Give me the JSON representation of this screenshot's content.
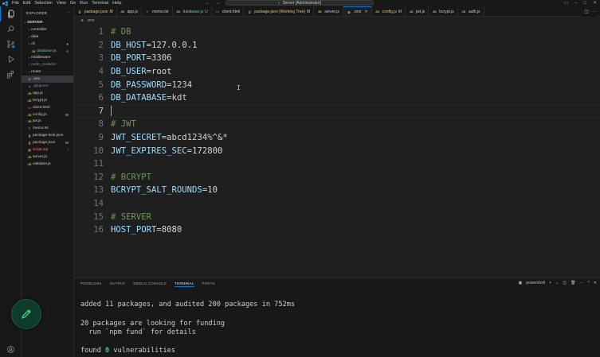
{
  "titlebar": {
    "menu": [
      "File",
      "Edit",
      "Selection",
      "View",
      "Go",
      "Run",
      "Terminal",
      "Help"
    ],
    "search_text": "Server [Administrator]"
  },
  "sidebar": {
    "title": "EXPLORER",
    "tree": [
      {
        "label": "SERVER",
        "kind": "root",
        "indent": 0,
        "chev": "⌄"
      },
      {
        "label": "controller",
        "kind": "folder",
        "indent": 1,
        "chev": "›"
      },
      {
        "label": "data",
        "kind": "folder",
        "indent": 1,
        "chev": "›"
      },
      {
        "label": "db",
        "kind": "folder",
        "indent": 1,
        "chev": "⌄",
        "color": "green",
        "badge": "●",
        "badge_color": "green"
      },
      {
        "label": "database.js",
        "kind": "js",
        "indent": 2,
        "color": "green",
        "badge": "U",
        "badge_color": "green"
      },
      {
        "label": "middleware",
        "kind": "folder",
        "indent": 1,
        "chev": "›"
      },
      {
        "label": "node_modules",
        "kind": "folder",
        "indent": 1,
        "chev": "›",
        "color": "gray"
      },
      {
        "label": "router",
        "kind": "folder",
        "indent": 1,
        "chev": "›"
      },
      {
        "label": ".env",
        "kind": "env",
        "indent": 1,
        "selected": true
      },
      {
        "label": ".gitignore",
        "kind": "git",
        "indent": 1,
        "color": "gray"
      },
      {
        "label": "app.js",
        "kind": "js",
        "indent": 1
      },
      {
        "label": "bcrypt.js",
        "kind": "js",
        "indent": 1
      },
      {
        "label": "client.html",
        "kind": "html",
        "indent": 1
      },
      {
        "label": "config.js",
        "kind": "js",
        "indent": 1,
        "color": "orange",
        "badge": "M",
        "badge_color": "orange"
      },
      {
        "label": "jwt.js",
        "kind": "js",
        "indent": 1
      },
      {
        "label": "memo.txt",
        "kind": "txt",
        "indent": 1
      },
      {
        "label": "package-lock.json",
        "kind": "json",
        "indent": 1
      },
      {
        "label": "package.json",
        "kind": "json",
        "indent": 1,
        "color": "orange",
        "badge": "M",
        "badge_color": "orange"
      },
      {
        "label": "script.sql",
        "kind": "sql",
        "indent": 1,
        "color": "red",
        "badge": "!",
        "badge_color": "red"
      },
      {
        "label": "server.js",
        "kind": "js",
        "indent": 1
      },
      {
        "label": "validator.js",
        "kind": "js",
        "indent": 1
      }
    ]
  },
  "tabs": [
    {
      "icon": "{}",
      "label": "package.json",
      "badge": "M",
      "color": "orange"
    },
    {
      "icon": "JS",
      "label": "app.js"
    },
    {
      "icon": "≡",
      "label": "memo.txt"
    },
    {
      "icon": "JS",
      "label": "database.js",
      "badge": "U",
      "color": "green"
    },
    {
      "icon": "<>",
      "label": "client.html"
    },
    {
      "icon": "{}",
      "label": "package.json (Working Tree)",
      "badge": "M",
      "color": "orange"
    },
    {
      "icon": "JS",
      "label": "server.js"
    },
    {
      "icon": "⚙",
      "label": ".env",
      "active": true
    },
    {
      "icon": "JS",
      "label": "config.js",
      "badge": "M",
      "color": "orange"
    },
    {
      "icon": "JS",
      "label": "jwt.js"
    },
    {
      "icon": "JS",
      "label": "bcrypt.js"
    },
    {
      "icon": "JS",
      "label": "auth.js"
    }
  ],
  "breadcrumb": [
    ".env"
  ],
  "editor": {
    "current_line": 7,
    "lines": [
      {
        "n": "1",
        "type": "comment",
        "text": "# DB"
      },
      {
        "n": "2",
        "type": "kv",
        "key": "DB_HOST",
        "value": "127.0.0.1"
      },
      {
        "n": "3",
        "type": "kv",
        "key": "DB_PORT",
        "value": "3306"
      },
      {
        "n": "4",
        "type": "kv",
        "key": "DB_USER",
        "value": "root"
      },
      {
        "n": "5",
        "type": "kv",
        "key": "DB_PASSWORD",
        "value": "1234"
      },
      {
        "n": "6",
        "type": "kv",
        "key": "DB_DATABASE",
        "value": "kdt"
      },
      {
        "n": "7",
        "type": "empty",
        "text": ""
      },
      {
        "n": "8",
        "type": "comment",
        "text": "# JWT"
      },
      {
        "n": "9",
        "type": "kv",
        "key": "JWT_SECRET",
        "value": "abcd1234%^&*"
      },
      {
        "n": "10",
        "type": "kv",
        "key": "JWT_EXPIRES_SEC",
        "value": "172800"
      },
      {
        "n": "11",
        "type": "empty",
        "text": ""
      },
      {
        "n": "12",
        "type": "comment",
        "text": "# BCRYPT"
      },
      {
        "n": "13",
        "type": "kv",
        "key": "BCRYPT_SALT_ROUNDS",
        "value": "10"
      },
      {
        "n": "14",
        "type": "empty",
        "text": ""
      },
      {
        "n": "15",
        "type": "comment",
        "text": "# SERVER"
      },
      {
        "n": "16",
        "type": "kv",
        "key": "HOST_PORT",
        "value": "8080"
      }
    ]
  },
  "panel": {
    "tabs": [
      "PROBLEMS",
      "OUTPUT",
      "DEBUG CONSOLE",
      "TERMINAL",
      "PORTS"
    ],
    "active_tab": "TERMINAL",
    "terminal_name": "powershell",
    "terminal": {
      "l1": "added 11 packages, and audited 200 packages in 752ms",
      "l2": "20 packages are looking for funding",
      "l3": "  run `npm fund` for details",
      "l4_prefix": "found ",
      "l4_num": "0",
      "l4_suffix": " vulnerabilities"
    }
  },
  "colors": {
    "accent": "#0078d4",
    "comment": "#6a9955",
    "key": "#9cdcfe",
    "fab_bg": "#0d3b2c"
  }
}
